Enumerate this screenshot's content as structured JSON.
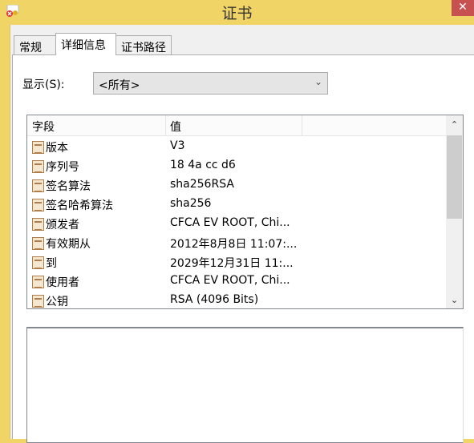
{
  "window": {
    "title": "证书",
    "close_glyph": "✕"
  },
  "tabs": [
    {
      "label": "常规"
    },
    {
      "label": "详细信息",
      "active": true
    },
    {
      "label": "证书路径"
    }
  ],
  "show": {
    "label": "显示(S):",
    "selected": "<所有>"
  },
  "list": {
    "columns": [
      "字段",
      "值"
    ],
    "rows": [
      {
        "field": "版本",
        "value": "V3"
      },
      {
        "field": "序列号",
        "value": "18 4a cc d6"
      },
      {
        "field": "签名算法",
        "value": "sha256RSA"
      },
      {
        "field": "签名哈希算法",
        "value": "sha256"
      },
      {
        "field": "颁发者",
        "value": "CFCA EV ROOT, Chi..."
      },
      {
        "field": "有效期从",
        "value": "2012年8月8日 11:07:..."
      },
      {
        "field": "到",
        "value": "2029年12月31日 11:..."
      },
      {
        "field": "使用者",
        "value": "CFCA EV ROOT, Chi..."
      },
      {
        "field": "公钥",
        "value": "RSA (4096 Bits)"
      }
    ]
  },
  "detail": {
    "value": ""
  }
}
